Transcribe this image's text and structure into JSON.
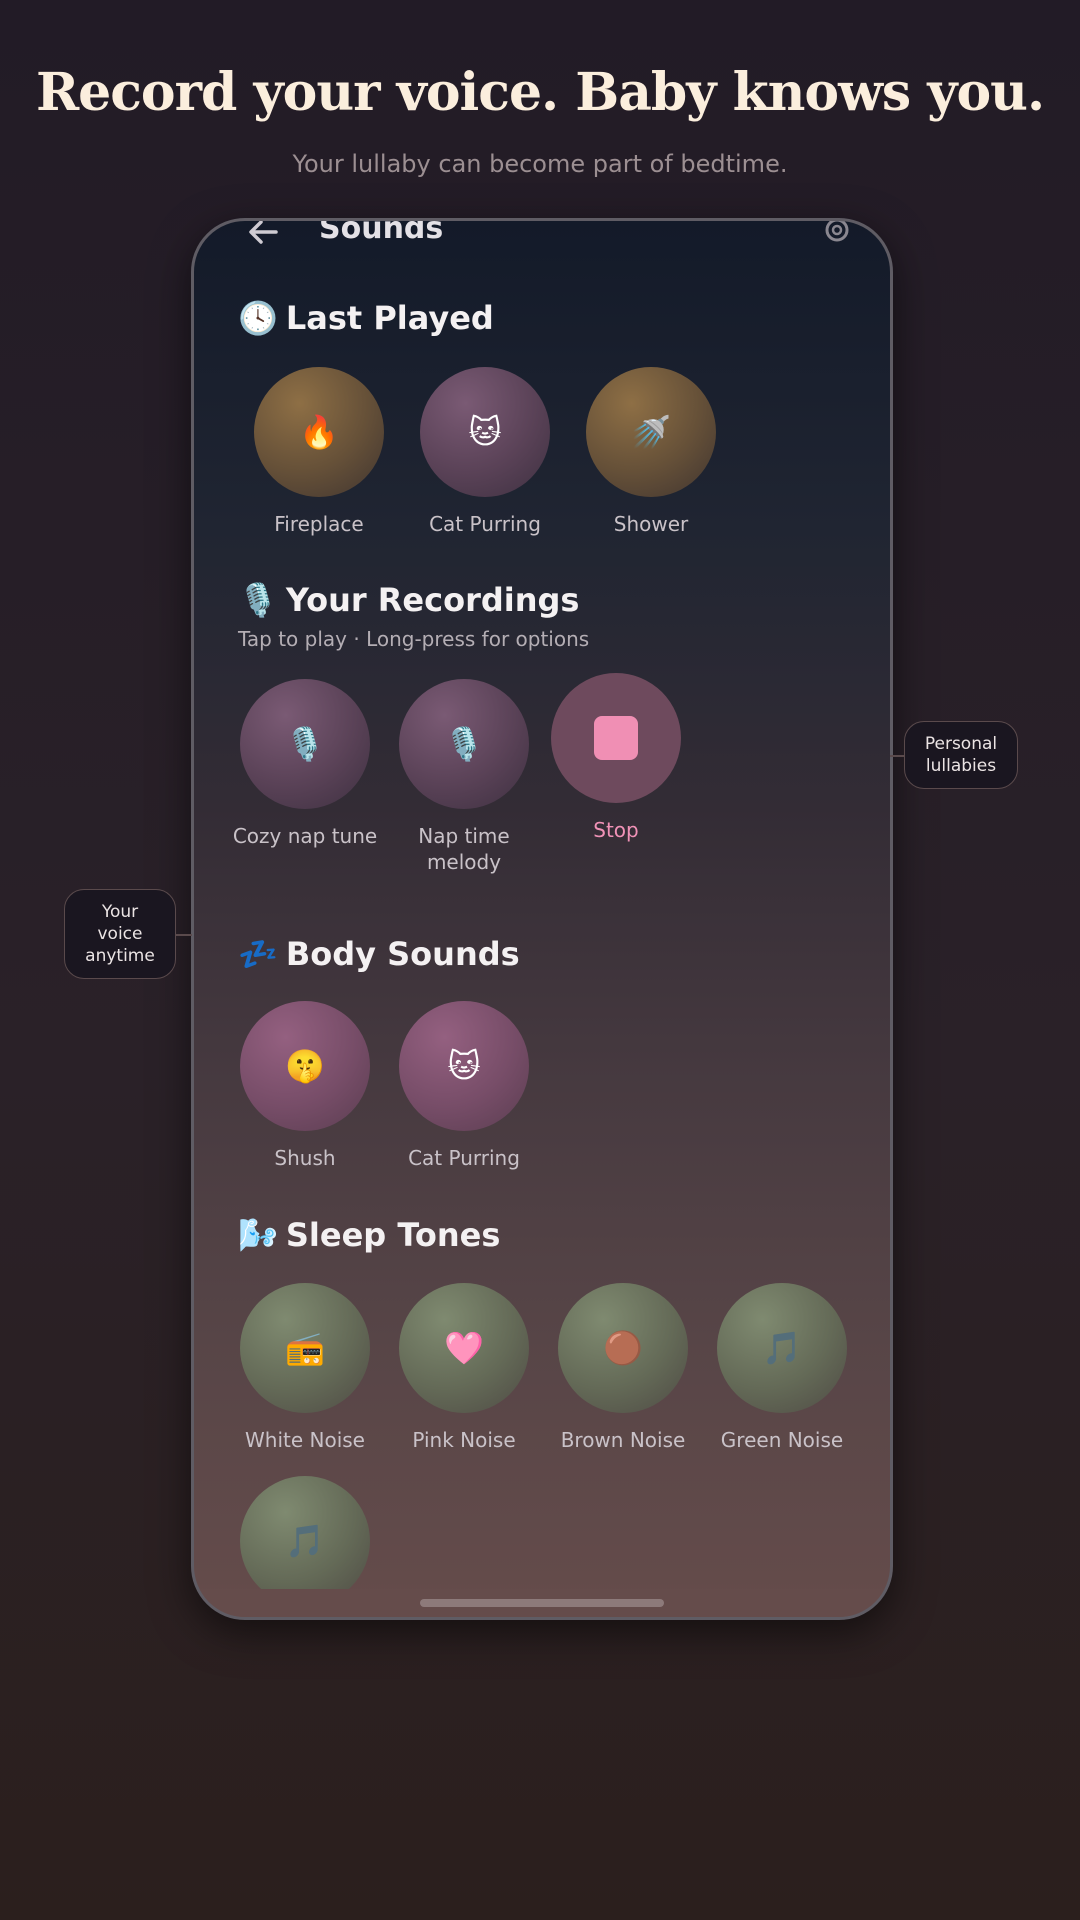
{
  "headline": "Record your voice. Baby knows you.",
  "subheadline": "Your lullaby can become part of bedtime.",
  "screen": {
    "title": "Sounds",
    "back_icon": "arrow-left-icon",
    "settings_icon": "gear-icon"
  },
  "sections": {
    "last_played": {
      "emoji": "🕓",
      "title": "Last Played",
      "items": [
        {
          "emoji": "🔥",
          "label": "Fireplace"
        },
        {
          "emoji": "🐱",
          "label": "Cat Purring"
        },
        {
          "emoji": "🚿",
          "label": "Shower"
        }
      ]
    },
    "recordings": {
      "emoji": "🎙️",
      "title": "Your Recordings",
      "hint": "Tap to play · Long-press for options",
      "items": [
        {
          "emoji": "🎙️",
          "label": "Cozy nap tune"
        },
        {
          "emoji": "🎙️",
          "label": "Nap time melody"
        }
      ],
      "stop_label": "Stop"
    },
    "body_sounds": {
      "emoji": "💤",
      "title": "Body Sounds",
      "items": [
        {
          "emoji": "🤫",
          "label": "Shush"
        },
        {
          "emoji": "🐱",
          "label": "Cat Purring"
        }
      ]
    },
    "sleep_tones": {
      "emoji": "🌬️",
      "title": "Sleep Tones",
      "items": [
        {
          "emoji": "📻",
          "label": "White Noise"
        },
        {
          "emoji": "🩷",
          "label": "Pink Noise"
        },
        {
          "emoji": "🟤",
          "label": "Brown Noise"
        },
        {
          "emoji": "🎵",
          "label": "Green Noise"
        },
        {
          "emoji": "🎵",
          "label": ""
        }
      ]
    }
  },
  "callouts": {
    "right": "Personal lullabies",
    "left": "Your voice anytime"
  },
  "colors": {
    "accent_pink": "#f08fb4",
    "headline": "#fbeedd"
  }
}
